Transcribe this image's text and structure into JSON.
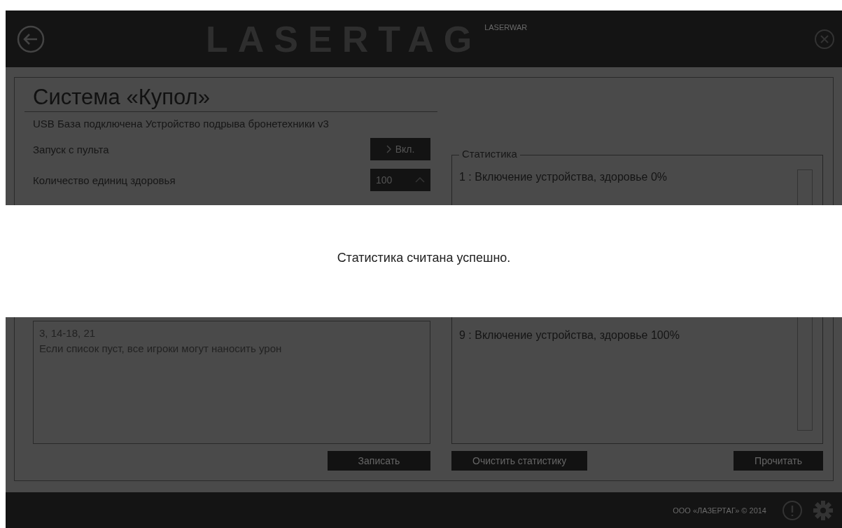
{
  "header": {
    "logo": "LASERTAG",
    "brand": "LASERWAR"
  },
  "title": "Система «Купол»",
  "status": "USB База подключена Устройство подрыва бронетехники v3",
  "settings": [
    {
      "kind": "toggle",
      "label": "Запуск с пульта",
      "value": "Вкл."
    },
    {
      "kind": "spinner",
      "label": "Количество единиц здоровья",
      "value": "100"
    }
  ],
  "players_hint": [
    "3, 14-18, 21",
    "Если список пуст, все игроки могут наносить урон"
  ],
  "write_button": "Записать",
  "statistics": {
    "legend": "Статистика",
    "entries": [
      "1 : Включение устройства, здоровье 0%",
      "9 : Включение устройства, здоровье 100%"
    ]
  },
  "clear_button": "Очистить статистику",
  "read_button": "Прочитать",
  "footer": {
    "copyright": "ООО «ЛАЗЕРТАГ» © 2014"
  },
  "dialog": {
    "message": "Статистика считана успешно."
  }
}
